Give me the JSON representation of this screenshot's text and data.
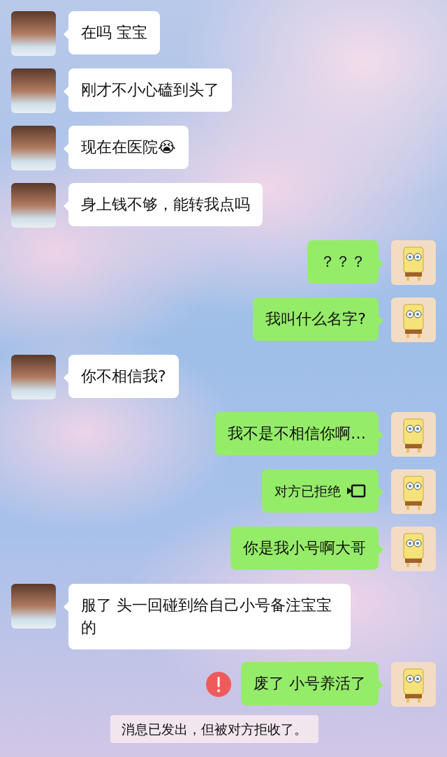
{
  "messages": [
    {
      "outgoing": false,
      "kind": "text",
      "text": "在吗  宝宝",
      "failed": false
    },
    {
      "outgoing": false,
      "kind": "text",
      "text": "刚才不小心磕到头了",
      "failed": false
    },
    {
      "outgoing": false,
      "kind": "text",
      "text": "现在在医院😭",
      "failed": false
    },
    {
      "outgoing": false,
      "kind": "text",
      "text": "身上钱不够，能转我点吗",
      "failed": false
    },
    {
      "outgoing": true,
      "kind": "text",
      "text": "？？？",
      "failed": false
    },
    {
      "outgoing": true,
      "kind": "text",
      "text": "我叫什么名字?",
      "failed": false
    },
    {
      "outgoing": false,
      "kind": "text",
      "text": "你不相信我?",
      "failed": false
    },
    {
      "outgoing": true,
      "kind": "text",
      "text": "我不是不相信你啊…",
      "failed": false
    },
    {
      "outgoing": true,
      "kind": "video_call",
      "text": "对方已拒绝",
      "failed": false
    },
    {
      "outgoing": true,
      "kind": "text",
      "text": "你是我小号啊大哥",
      "failed": false
    },
    {
      "outgoing": false,
      "kind": "text",
      "text": "服了  头一回碰到给自己小号备注宝宝的",
      "failed": false
    },
    {
      "outgoing": true,
      "kind": "text",
      "text": "废了  小号养活了",
      "failed": true
    }
  ],
  "system_notice": "消息已发出，但被对方拒收了。"
}
